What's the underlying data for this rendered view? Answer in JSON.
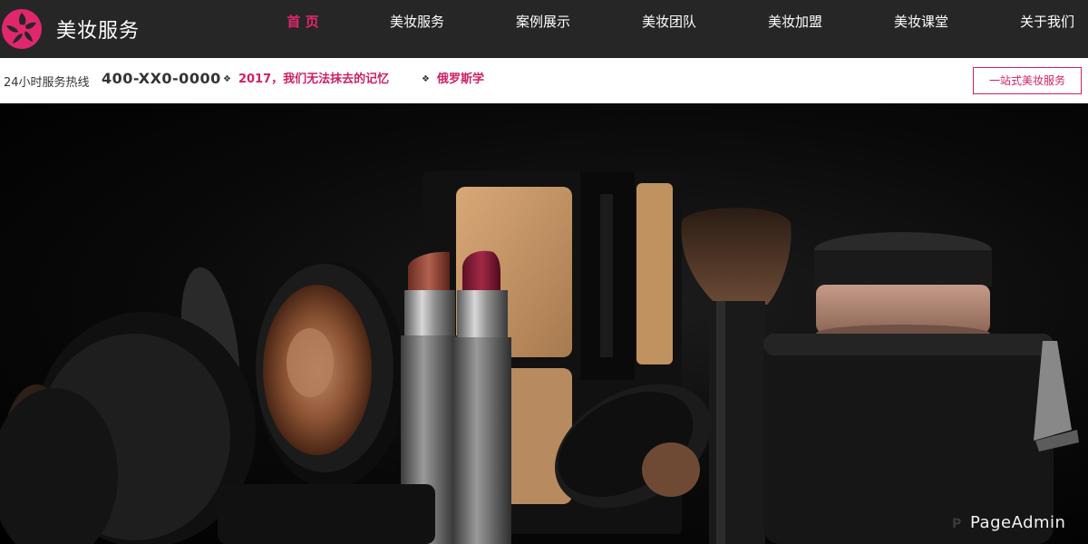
{
  "header": {
    "brand": "美妆服务",
    "nav": [
      {
        "label": "首 页",
        "active": true
      },
      {
        "label": "美妆服务",
        "active": false
      },
      {
        "label": "案例展示",
        "active": false
      },
      {
        "label": "美妆团队",
        "active": false
      },
      {
        "label": "美妆加盟",
        "active": false
      },
      {
        "label": "美妆课堂",
        "active": false
      },
      {
        "label": "关于我们",
        "active": false
      }
    ]
  },
  "infobar": {
    "hotline_label": "24小时服务热线",
    "hotline_number": "400-XX0-0000",
    "news": [
      {
        "title": "2017，我们无法抹去的记忆"
      },
      {
        "title": "俄罗斯学"
      }
    ],
    "cta_label": "一站式美妆服务"
  },
  "banner": {
    "watermark": "PageAdmin",
    "watermark_mark": "P"
  },
  "colors": {
    "accent": "#cf1f66",
    "nav_active": "#e0276e",
    "header_bg": "#262626"
  }
}
